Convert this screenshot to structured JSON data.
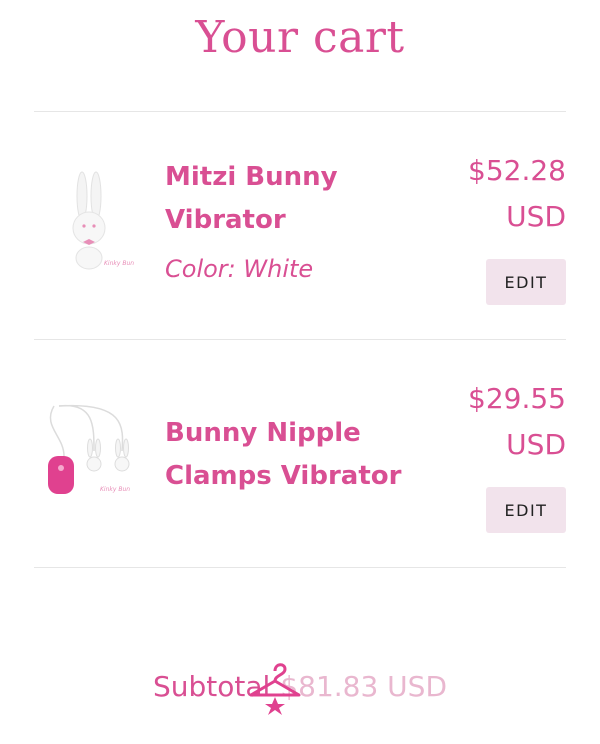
{
  "page": {
    "title": "Your cart"
  },
  "cart": {
    "items": [
      {
        "name_line1": "Mitzi Bunny",
        "name_line2": "Vibrator",
        "variant": "Color: White",
        "price_amount": "$52.28",
        "price_currency": "USD",
        "edit_label": "EDIT",
        "image_icon": "bunny-vibrator-product"
      },
      {
        "name_line1": "Bunny Nipple",
        "name_line2": "Clamps Vibrator",
        "price_amount": "$29.55",
        "price_currency": "USD",
        "edit_label": "EDIT",
        "image_icon": "bunny-nipple-clamps-product"
      }
    ]
  },
  "subtotal": {
    "label": "Subtotal",
    "amount": "$81.83 USD"
  },
  "colors": {
    "accent": "#d94f93",
    "button_bg": "#f2e3ec",
    "divider": "#e6e6e6"
  }
}
